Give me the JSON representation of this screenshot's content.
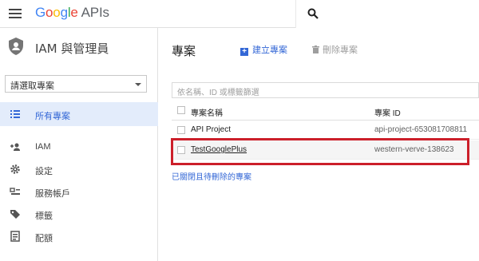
{
  "topbar": {
    "logo_parts": [
      "G",
      "o",
      "o",
      "g",
      "l",
      "e"
    ],
    "logo_suffix": "APIs"
  },
  "sidebar": {
    "title": "IAM 與管理員",
    "project_select": "請選取專案",
    "items": [
      {
        "label": "所有專案",
        "icon": "list-icon"
      },
      {
        "label": "IAM",
        "icon": "add-person-icon"
      },
      {
        "label": "設定",
        "icon": "gear-icon"
      },
      {
        "label": "服務帳戶",
        "icon": "service-account-icon"
      },
      {
        "label": "標籤",
        "icon": "label-icon"
      },
      {
        "label": "配額",
        "icon": "quota-icon"
      }
    ]
  },
  "main": {
    "title": "專案",
    "create_label": "建立專案",
    "delete_label": "刪除專案",
    "filter_placeholder": "依名稱、ID 或標籤篩選",
    "columns": {
      "name": "專案名稱",
      "id": "專案 ID"
    },
    "rows": [
      {
        "name": "API Project",
        "id": "api-project-653081708811"
      },
      {
        "name": "TestGooglePlus",
        "id": "western-verve-138623"
      }
    ],
    "deleted_link": "已關閉且待刪除的專案"
  },
  "colors": {
    "accent": "#3367d6",
    "highlight_box": "#cc1f2a",
    "active_nav_bg": "#e3ecfb"
  }
}
